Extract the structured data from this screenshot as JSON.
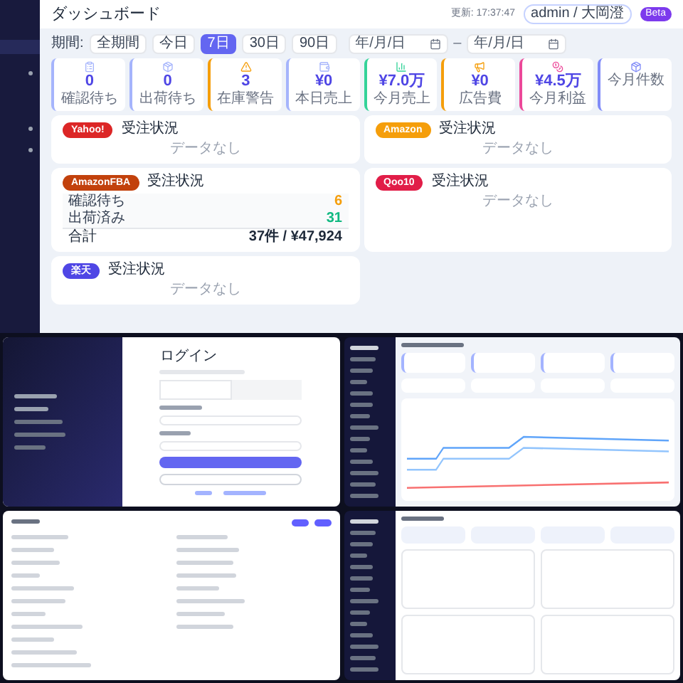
{
  "dashboard": {
    "title": "ダッシュボード",
    "updated": "更新: 17:37:47",
    "user": "admin / 大岡澄",
    "user_badge": "Beta",
    "period_label": "期間:",
    "periods": [
      {
        "label": "全期間",
        "selected": false
      },
      {
        "label": "今日",
        "selected": false
      },
      {
        "label": "7日",
        "selected": true
      },
      {
        "label": "30日",
        "selected": false
      },
      {
        "label": "90日",
        "selected": false
      }
    ],
    "date_from": {
      "placeholder": "年/月/日"
    },
    "date_separator": "–",
    "date_to": {
      "placeholder": "年/月/日"
    },
    "stats": [
      {
        "value": "0",
        "label": "確認待ち",
        "color": "#a5b4fc"
      },
      {
        "value": "0",
        "label": "出荷待ち",
        "color": "#a5b4fc"
      },
      {
        "value": "3",
        "label": "在庫警告",
        "color": "#f59e0b"
      },
      {
        "value": "¥0",
        "label": "本日売上",
        "color": "#a5b4fc"
      },
      {
        "value": "¥7.0万",
        "label": "今月売上",
        "color": "#34d399"
      },
      {
        "value": "¥0",
        "label": "広告費",
        "color": "#f59e0b"
      },
      {
        "value": "¥4.5万",
        "label": "今月利益",
        "color": "#ec4899"
      },
      {
        "label": "今月件数",
        "color": "#818cf8"
      }
    ],
    "channels": [
      {
        "kind": "empty",
        "badge": "Yahoo!",
        "color": "#dc2626",
        "title": "受注状況",
        "empty": "データなし"
      },
      {
        "kind": "empty",
        "badge": "Amazon",
        "color": "#f59e0b",
        "title": "受注状況",
        "empty": "データなし"
      },
      {
        "kind": "summary",
        "badge": "AmazonFBA",
        "color": "#c2410c",
        "title": "受注状況",
        "rows": [
          {
            "label": "確認待ち",
            "value": "6",
            "color": "#f59e0b"
          },
          {
            "label": "出荷済み",
            "value": "31",
            "color": "#10b981"
          }
        ],
        "total_label": "合計",
        "total": "37件 / ¥47,924"
      },
      {
        "kind": "empty",
        "badge": "Qoo10",
        "color": "#e11d48",
        "title": "受注状況",
        "empty": "データなし"
      },
      {
        "kind": "empty",
        "badge": "楽天",
        "color": "#4f46e5",
        "title": "受注状況",
        "empty": "データなし"
      }
    ]
  },
  "login": {
    "title": "ログイン"
  }
}
